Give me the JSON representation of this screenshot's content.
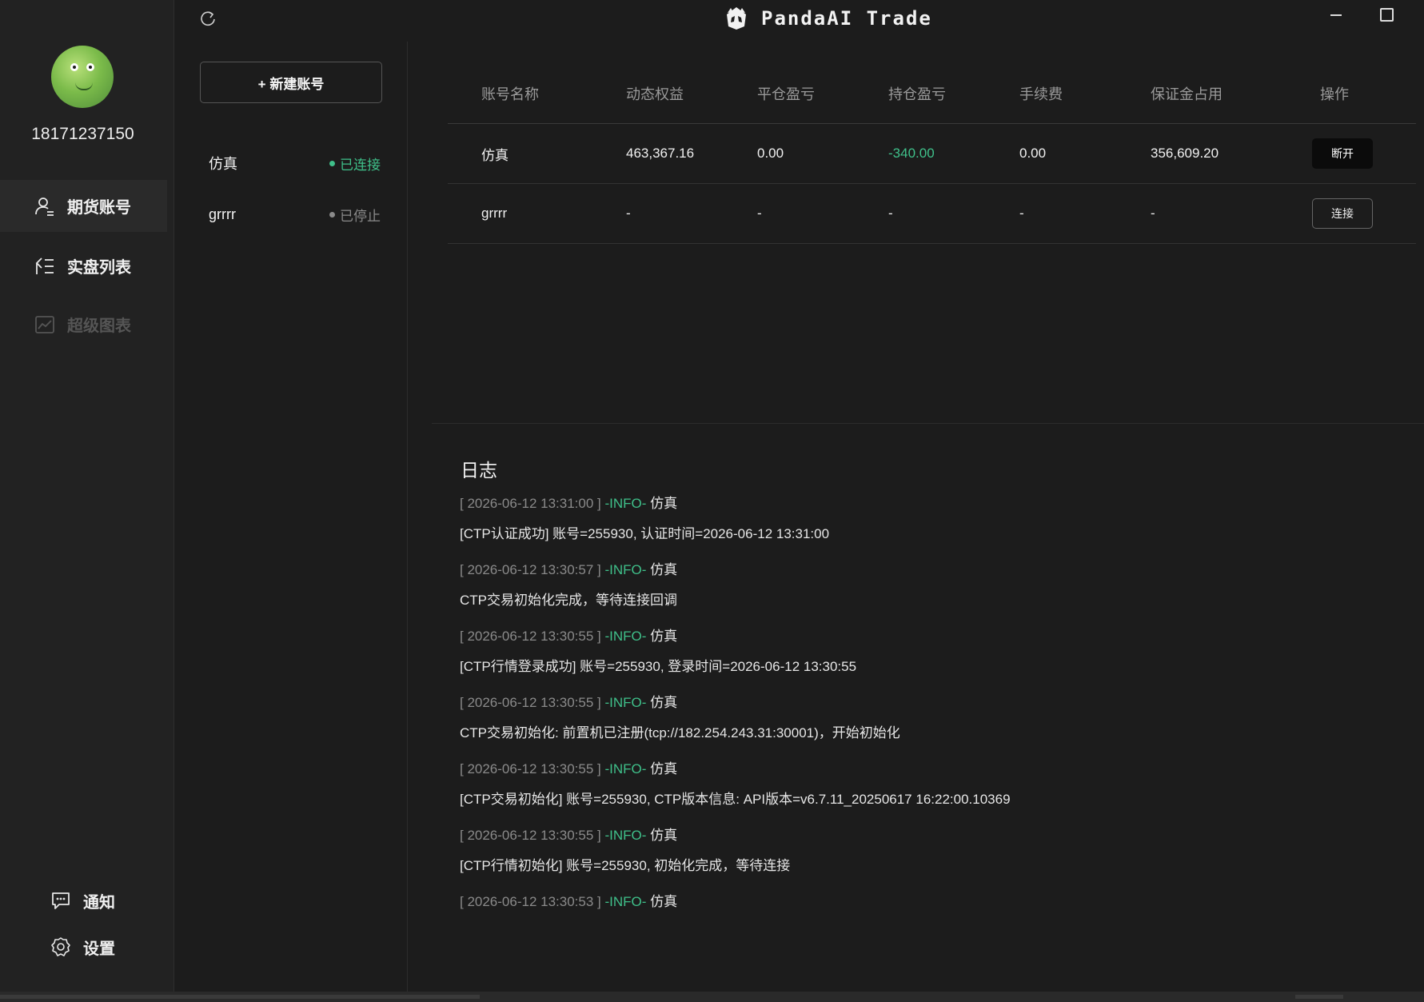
{
  "user": {
    "phone": "18171237150"
  },
  "nav": {
    "items": [
      {
        "label": "期货账号"
      },
      {
        "label": "实盘列表"
      },
      {
        "label": "超级图表"
      }
    ],
    "notify_label": "通知",
    "settings_label": "设置"
  },
  "titlebar": {
    "app_name": "PandaAI Trade"
  },
  "accounts": {
    "new_button": "+ 新建账号",
    "list": [
      {
        "name": "仿真",
        "status": "已连接",
        "status_color": "#3fc08a"
      },
      {
        "name": "grrrr",
        "status": "已停止",
        "status_color": "#8a8a8a"
      }
    ]
  },
  "table": {
    "headers": [
      "账号名称",
      "动态权益",
      "平仓盈亏",
      "持仓盈亏",
      "手续费",
      "保证金占用",
      "操作"
    ],
    "rows": [
      {
        "name": "仿真",
        "equity": "463,367.16",
        "close_pnl": "0.00",
        "pos_pnl": "-340.00",
        "fee": "0.00",
        "margin": "356,609.20",
        "action": "断开"
      },
      {
        "name": "grrrr",
        "equity": "-",
        "close_pnl": "-",
        "pos_pnl": "-",
        "fee": "-",
        "margin": "-",
        "action": "连接"
      }
    ]
  },
  "log": {
    "title": "日志",
    "level_color": "#3fc08a",
    "entries": [
      {
        "time": "[ 2026-06-12 13:31:00 ]",
        "level": "-INFO-",
        "source": "仿真",
        "message": "[CTP认证成功] 账号=255930, 认证时间=2026-06-12 13:31:00"
      },
      {
        "time": "[ 2026-06-12 13:30:57 ]",
        "level": "-INFO-",
        "source": "仿真",
        "message": "CTP交易初始化完成，等待连接回调"
      },
      {
        "time": "[ 2026-06-12 13:30:55 ]",
        "level": "-INFO-",
        "source": "仿真",
        "message": "[CTP行情登录成功] 账号=255930, 登录时间=2026-06-12 13:30:55"
      },
      {
        "time": "[ 2026-06-12 13:30:55 ]",
        "level": "-INFO-",
        "source": "仿真",
        "message": "CTP交易初始化: 前置机已注册(tcp://182.254.243.31:30001)，开始初始化"
      },
      {
        "time": "[ 2026-06-12 13:30:55 ]",
        "level": "-INFO-",
        "source": "仿真",
        "message": "[CTP交易初始化] 账号=255930, CTP版本信息: API版本=v6.7.11_20250617 16:22:00.10369"
      },
      {
        "time": "[ 2026-06-12 13:30:55 ]",
        "level": "-INFO-",
        "source": "仿真",
        "message": "[CTP行情初始化] 账号=255930, 初始化完成，等待连接"
      },
      {
        "time": "[ 2026-06-12 13:30:53 ]",
        "level": "-INFO-",
        "source": "仿真",
        "message": ""
      }
    ]
  }
}
